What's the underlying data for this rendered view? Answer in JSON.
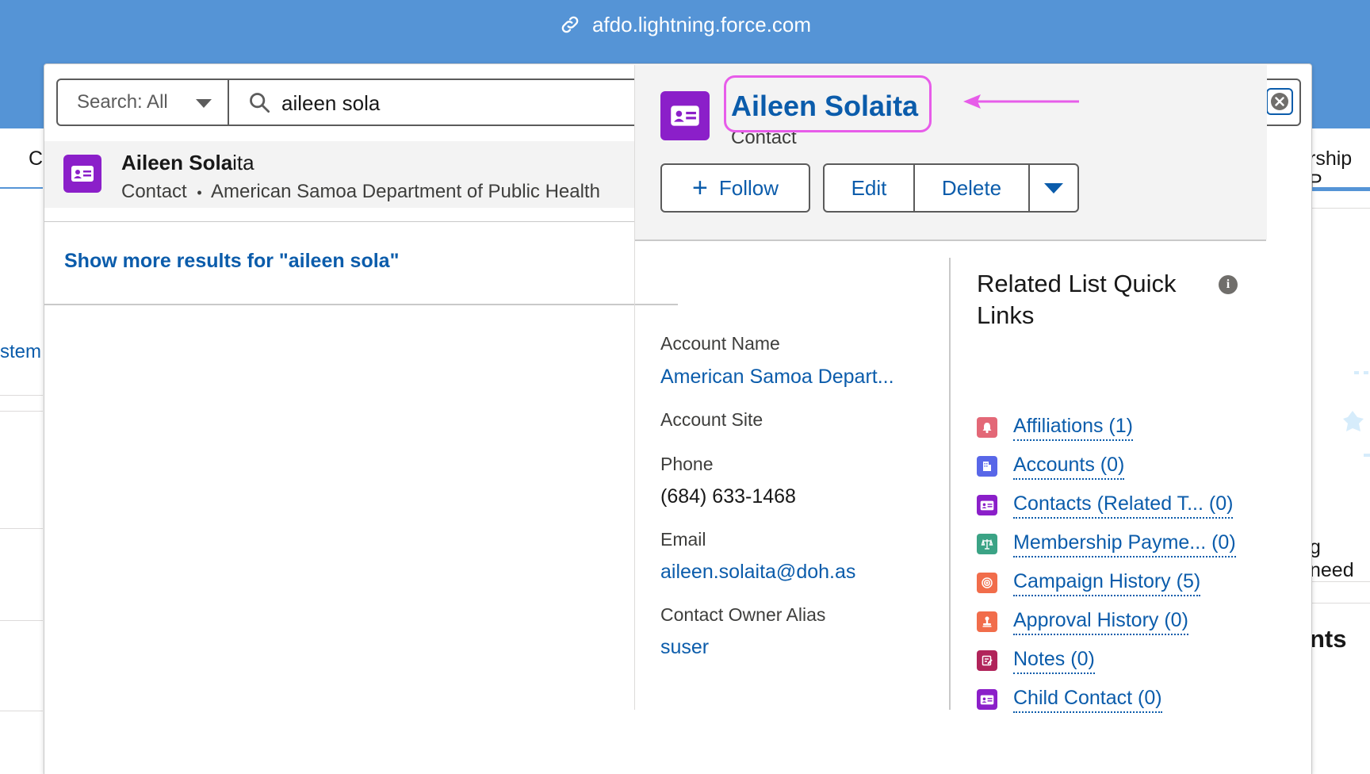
{
  "browser": {
    "url": "afdo.lightning.force.com"
  },
  "background": {
    "tab_fragment_left": "C",
    "tab_fragment_right": "rship P",
    "left_link_fragment": "stem",
    "right_text_fragment": "g need",
    "right_heading_fragment": "nts"
  },
  "search": {
    "scope_label": "Search: All",
    "query": "aileen sola"
  },
  "results": [
    {
      "name_match": "Aileen Sola",
      "name_rest": "ita",
      "type": "Contact",
      "separator": "•",
      "account": "American Samoa Department of Public Health"
    }
  ],
  "show_more": "Show more results for \"aileen sola\"",
  "preview": {
    "name": "Aileen Solaita",
    "type": "Contact",
    "buttons": {
      "follow": "Follow",
      "edit": "Edit",
      "delete": "Delete"
    },
    "fields": {
      "account_name_label": "Account Name",
      "account_name_value": "American Samoa Depart...",
      "account_site_label": "Account Site",
      "phone_label": "Phone",
      "phone_value": "(684) 633-1468",
      "email_label": "Email",
      "email_value": "aileen.solaita@doh.as",
      "owner_label": "Contact Owner Alias",
      "owner_value": "suser"
    },
    "related": {
      "title": "Related List Quick Links",
      "items": [
        {
          "label": "Affiliations (1)",
          "color": "#e36877"
        },
        {
          "label": "Accounts (0)",
          "color": "#5867e8"
        },
        {
          "label": "Contacts (Related T... (0)",
          "color": "#8b1fc9"
        },
        {
          "label": "Membership Payme... (0)",
          "color": "#3ba385"
        },
        {
          "label": "Campaign History (5)",
          "color": "#f16d4b"
        },
        {
          "label": "Approval History (0)",
          "color": "#f16d4b"
        },
        {
          "label": "Notes (0)",
          "color": "#b1245a"
        },
        {
          "label": "Child Contact (0)",
          "color": "#8b1fc9"
        }
      ]
    }
  },
  "colors": {
    "brand_blue": "#5594d6",
    "link": "#0b5cab",
    "contact_purple": "#8b1fc9",
    "annotation": "#e75ce9"
  }
}
